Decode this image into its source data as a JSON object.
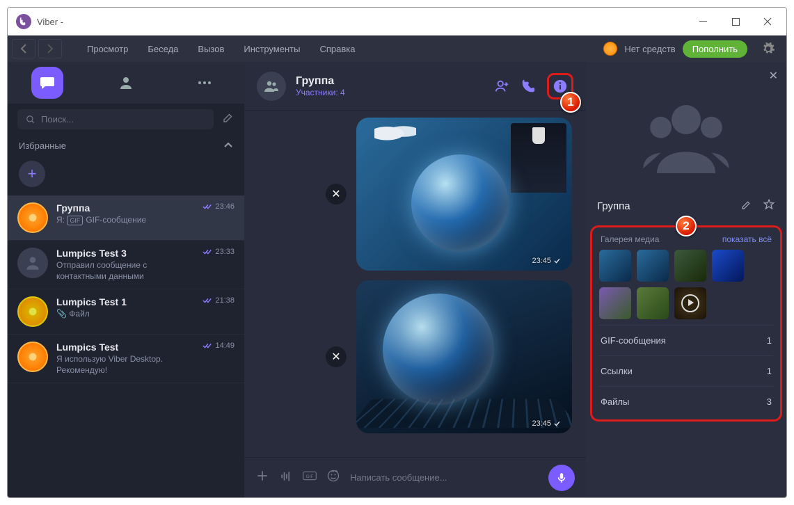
{
  "window": {
    "title": "Viber - "
  },
  "menubar": {
    "items": [
      "Просмотр",
      "Беседа",
      "Вызов",
      "Инструменты",
      "Справка"
    ],
    "balance": "Нет средств",
    "topup": "Пополнить"
  },
  "sidebar": {
    "search_placeholder": "Поиск...",
    "favorites_label": "Избранные",
    "chats": [
      {
        "name": "Группа",
        "sub": "Я: ",
        "sub2": "GIF-сообщение",
        "time": "23:46"
      },
      {
        "name": "Lumpics Test 3",
        "sub": "Отправил сообщение с контактными данными",
        "time": "23:33"
      },
      {
        "name": "Lumpics Test 1",
        "sub": "📎 Файл",
        "time": "21:38"
      },
      {
        "name": "Lumpics Test",
        "sub": "Я использую Viber Desktop. Рекомендую!",
        "time": "14:49"
      }
    ]
  },
  "chat": {
    "title": "Группа",
    "subtitle": "Участники: 4",
    "messages": [
      {
        "time": "23:45"
      },
      {
        "time": "23:45"
      }
    ],
    "input_placeholder": "Написать сообщение..."
  },
  "infopanel": {
    "name": "Группа",
    "gallery_label": "Галерея медиа",
    "show_all": "показать всё",
    "rows": [
      {
        "label": "GIF-сообщения",
        "count": "1"
      },
      {
        "label": "Ссылки",
        "count": "1"
      },
      {
        "label": "Файлы",
        "count": "3"
      }
    ]
  },
  "markers": {
    "one": "1",
    "two": "2"
  }
}
